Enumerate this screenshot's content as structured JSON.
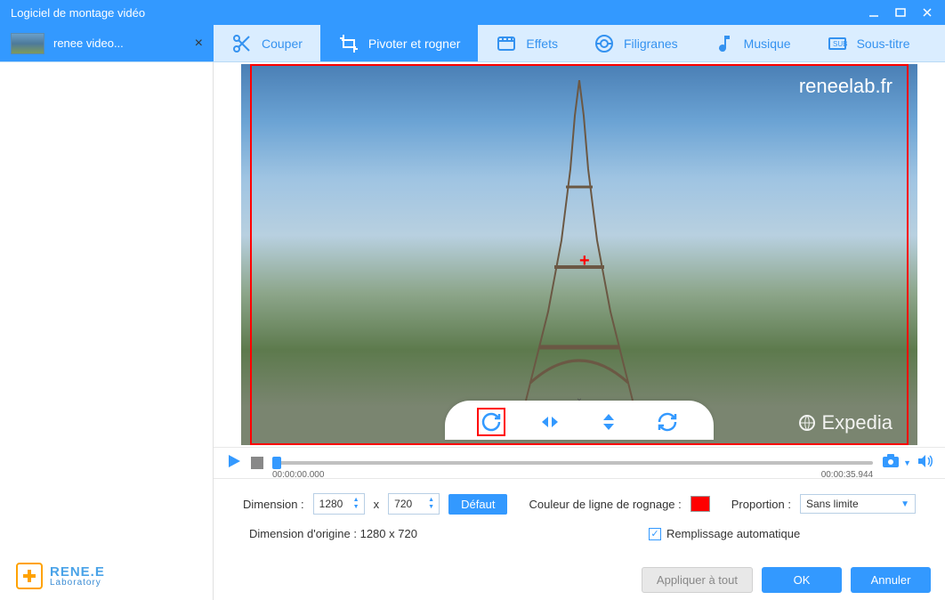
{
  "window": {
    "title": "Logiciel de montage vidéo"
  },
  "tab": {
    "label": "renee video..."
  },
  "modes": {
    "cut": "Couper",
    "rotate": "Pivoter et rogner",
    "effects": "Effets",
    "watermark": "Filigranes",
    "music": "Musique",
    "subtitle": "Sous-titre"
  },
  "preview": {
    "watermark_tl": "reneelab.fr",
    "watermark_br": "Expedia"
  },
  "timeline": {
    "start": "00:00:00.000",
    "end": "00:00:35.944"
  },
  "controls": {
    "dimension_label": "Dimension :",
    "width": "1280",
    "sep": "x",
    "height": "720",
    "default_btn": "Défaut",
    "crop_color_label": "Couleur de ligne de rognage :",
    "crop_color": "#ff0000",
    "proportion_label": "Proportion :",
    "proportion_value": "Sans limite",
    "orig_dim_label": "Dimension d'origine : 1280 x 720",
    "autofill_label": "Remplissage automatique"
  },
  "buttons": {
    "apply_all": "Appliquer à tout",
    "ok": "OK",
    "cancel": "Annuler"
  },
  "logo": {
    "main": "RENE.E",
    "sub": "Laboratory"
  }
}
